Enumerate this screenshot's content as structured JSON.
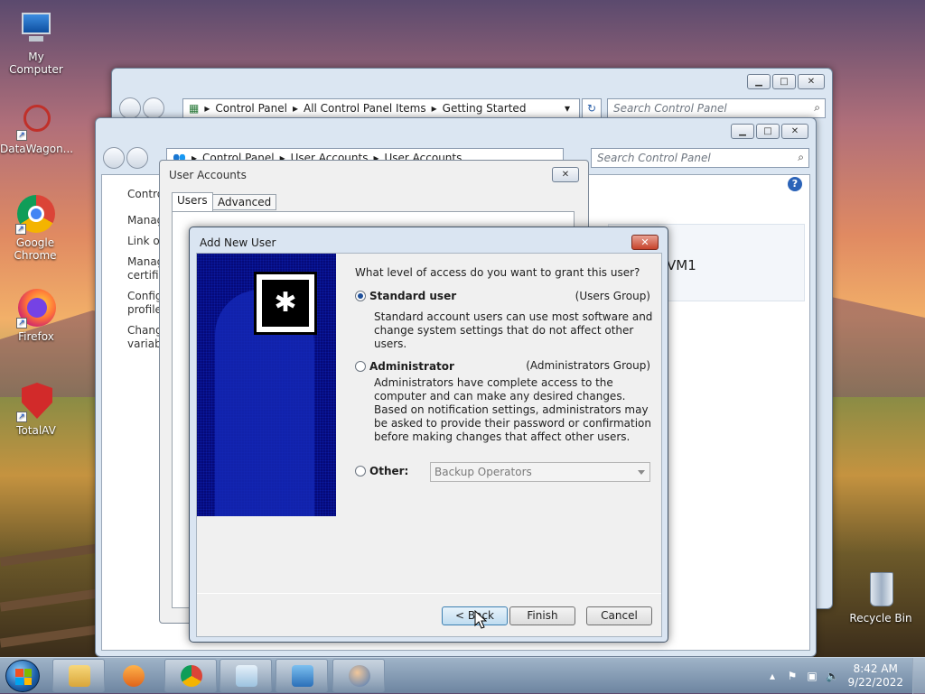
{
  "desktop": {
    "icons": [
      {
        "label": "My Computer"
      },
      {
        "label": "DataWagon..."
      },
      {
        "label": "Google Chrome"
      },
      {
        "label": "Firefox"
      },
      {
        "label": "TotalAV"
      },
      {
        "label": "Recycle Bin"
      }
    ]
  },
  "back_window": {
    "breadcrumb": [
      "Control Panel",
      "All Control Panel Items",
      "Getting Started"
    ],
    "search_placeholder": "Search Control Panel"
  },
  "mid_window": {
    "breadcrumb": [
      "Control Panel",
      "User Accounts",
      "User Accounts"
    ],
    "search_placeholder": "Search Control Panel",
    "left_links": [
      "Contro",
      "Manag",
      "Link or",
      "Manag certific",
      "Config profile",
      "Chang variabl"
    ],
    "partial_text": "VM1"
  },
  "user_accounts_dialog": {
    "title": "User Accounts",
    "tabs": [
      "Users",
      "Advanced"
    ]
  },
  "add_new_user": {
    "title": "Add New User",
    "question": "What level of access do you want to grant this user?",
    "standard": {
      "label": "Standard user",
      "group": "(Users Group)",
      "desc": "Standard account users can use most software and change system settings that do not affect other users.",
      "selected": true
    },
    "administrator": {
      "label": "Administrator",
      "group": "(Administrators Group)",
      "desc": "Administrators have complete access to the computer and can make any desired changes. Based on notification settings, administrators may be asked to provide their password or confirmation before making changes that affect other users.",
      "selected": false
    },
    "other": {
      "label": "Other:",
      "selected_value": "Backup Operators",
      "selected": false
    },
    "buttons": {
      "back": "< Back",
      "finish": "Finish",
      "cancel": "Cancel"
    }
  },
  "taskbar": {
    "time": "8:42 AM",
    "date": "9/22/2022"
  }
}
